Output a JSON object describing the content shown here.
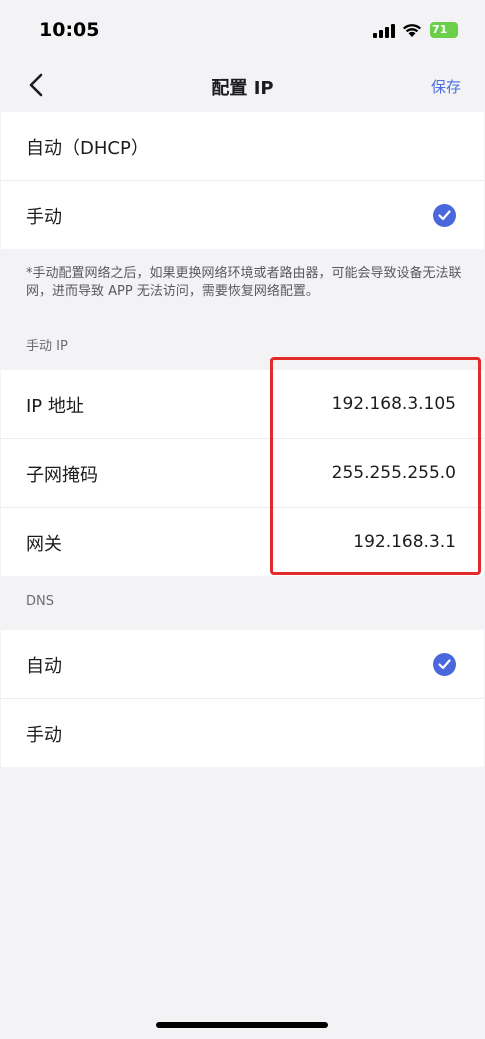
{
  "status_bar": {
    "time": "10:05",
    "battery": "71"
  },
  "nav": {
    "title": "配置 IP",
    "save": "保存"
  },
  "mode_options": [
    {
      "label": "自动（DHCP）",
      "selected": false
    },
    {
      "label": "手动",
      "selected": true
    }
  ],
  "note": "*手动配置网络之后，如果更换网络环境或者路由器，可能会导致设备无法联网，进而导致 APP 无法访问，需要恢复网络配置。",
  "manual_ip": {
    "section_label": "手动 IP",
    "fields": [
      {
        "label": "IP 地址",
        "value": "192.168.3.105"
      },
      {
        "label": "子网掩码",
        "value": "255.255.255.0"
      },
      {
        "label": "网关",
        "value": "192.168.3.1"
      }
    ]
  },
  "dns": {
    "section_label": "DNS",
    "options": [
      {
        "label": "自动",
        "selected": true
      },
      {
        "label": "手动",
        "selected": false
      }
    ]
  },
  "colors": {
    "accent": "#4a68dc",
    "highlight": "#e32a2a",
    "battery": "#6ccf4a"
  }
}
